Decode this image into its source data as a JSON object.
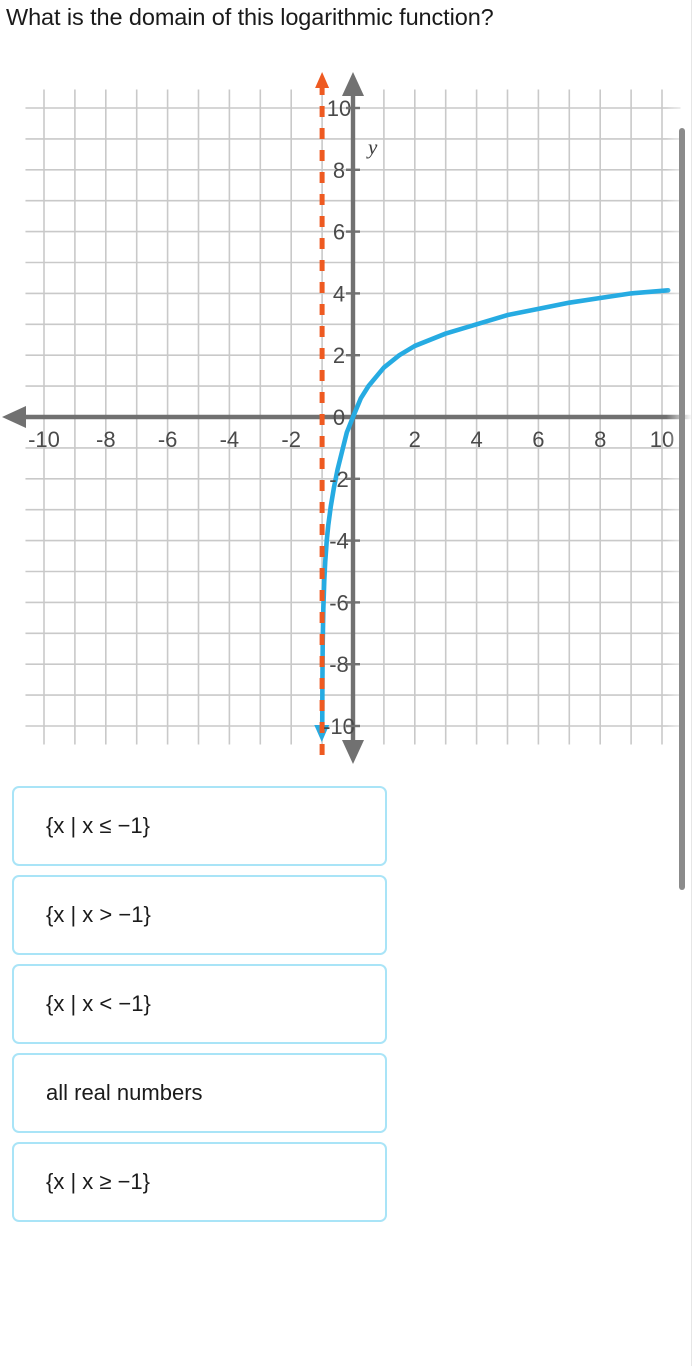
{
  "question": {
    "text": "What is the domain of this logarithmic function?"
  },
  "chart_data": {
    "type": "line",
    "title": "",
    "xlabel": "",
    "ylabel": "y",
    "y_axis_label": "y",
    "xlim": [
      -10.6,
      10.6
    ],
    "ylim": [
      -10.6,
      10.6
    ],
    "grid": true,
    "grid_step": 1,
    "x_ticks": [
      -10,
      -8,
      -6,
      -4,
      -2,
      0,
      2,
      4,
      6,
      8,
      10
    ],
    "x_tick_labels": [
      "-10",
      "-8",
      "-6",
      "-4",
      "-2",
      "0",
      "2",
      "4",
      "6",
      "8",
      "10"
    ],
    "y_ticks": [
      10,
      8,
      6,
      4,
      2,
      0,
      -2,
      -4,
      -6,
      -8,
      -10
    ],
    "y_tick_labels": [
      "10",
      "8",
      "6",
      "4",
      "2",
      "0",
      "-2",
      "-4",
      "-6",
      "-8",
      "-10"
    ],
    "series": [
      {
        "name": "logarithmic curve",
        "color": "#26ABE2",
        "style": "solid",
        "points": [
          [
            -0.995,
            -10.0
          ],
          [
            -0.99,
            -8.6
          ],
          [
            -0.98,
            -7.3
          ],
          [
            -0.96,
            -6.2
          ],
          [
            -0.93,
            -5.3
          ],
          [
            -0.9,
            -4.7
          ],
          [
            -0.85,
            -4.0
          ],
          [
            -0.8,
            -3.5
          ],
          [
            -0.72,
            -2.9
          ],
          [
            -0.62,
            -2.3
          ],
          [
            -0.5,
            -1.7
          ],
          [
            -0.35,
            -1.1
          ],
          [
            -0.2,
            -0.5
          ],
          [
            0.0,
            0.0
          ],
          [
            0.25,
            0.6
          ],
          [
            0.5,
            1.0
          ],
          [
            1.0,
            1.6
          ],
          [
            1.5,
            2.0
          ],
          [
            2.0,
            2.3
          ],
          [
            3.0,
            2.7
          ],
          [
            4.0,
            3.0
          ],
          [
            5.0,
            3.3
          ],
          [
            6.0,
            3.5
          ],
          [
            7.0,
            3.7
          ],
          [
            8.0,
            3.85
          ],
          [
            9.0,
            4.0
          ],
          [
            10.2,
            4.1
          ]
        ],
        "arrow_end": "bottom"
      }
    ],
    "asymptote": {
      "name": "vertical asymptote",
      "type": "vertical",
      "x": -1,
      "color": "#EE5A21",
      "style": "dashed",
      "arrow_end": "top"
    },
    "axes": {
      "x_axis_color": "#717171",
      "y_axis_color": "#717171",
      "x_arrow": "left",
      "y_arrow": "both"
    }
  },
  "options": [
    {
      "id": "option-1",
      "text": "{x | x ≤ −1}",
      "selected": false
    },
    {
      "id": "option-2",
      "text": "{x | x > −1}",
      "selected": false
    },
    {
      "id": "option-3",
      "text": "{x | x < −1}",
      "selected": false
    },
    {
      "id": "option-4",
      "text": "all real numbers",
      "selected": false
    },
    {
      "id": "option-5",
      "text": "{x | x ≥ −1}",
      "selected": false
    }
  ],
  "colors": {
    "curve": "#26ABE2",
    "asymptote": "#EE5A21",
    "grid": "#c9c9c9",
    "axis": "#717171",
    "option_border": "#a9e4f7",
    "text": "#1b1b1b",
    "scrollbar": "#8b8b8b"
  }
}
